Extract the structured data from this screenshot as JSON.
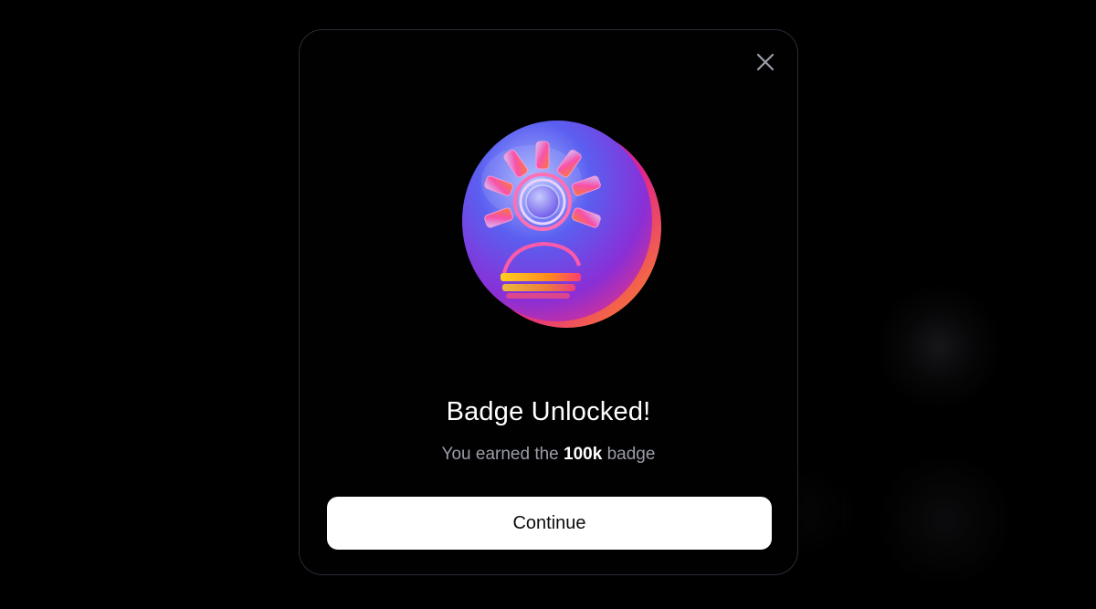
{
  "modal": {
    "close_icon": "close-icon",
    "badge_icon": "badge-coin-sun-icon",
    "title": "Badge Unlocked!",
    "subtitle_prefix": "You earned the ",
    "subtitle_highlight": "100k",
    "subtitle_suffix": " badge",
    "continue_label": "Continue"
  },
  "colors": {
    "background": "#000000",
    "modal_border": "#2a2c36",
    "button_bg": "#ffffff",
    "subtitle_text": "#9a9ca6",
    "badge_blue": "#4a6cf5",
    "badge_magenta": "#e0238f",
    "badge_orange": "#ff8a1e"
  }
}
